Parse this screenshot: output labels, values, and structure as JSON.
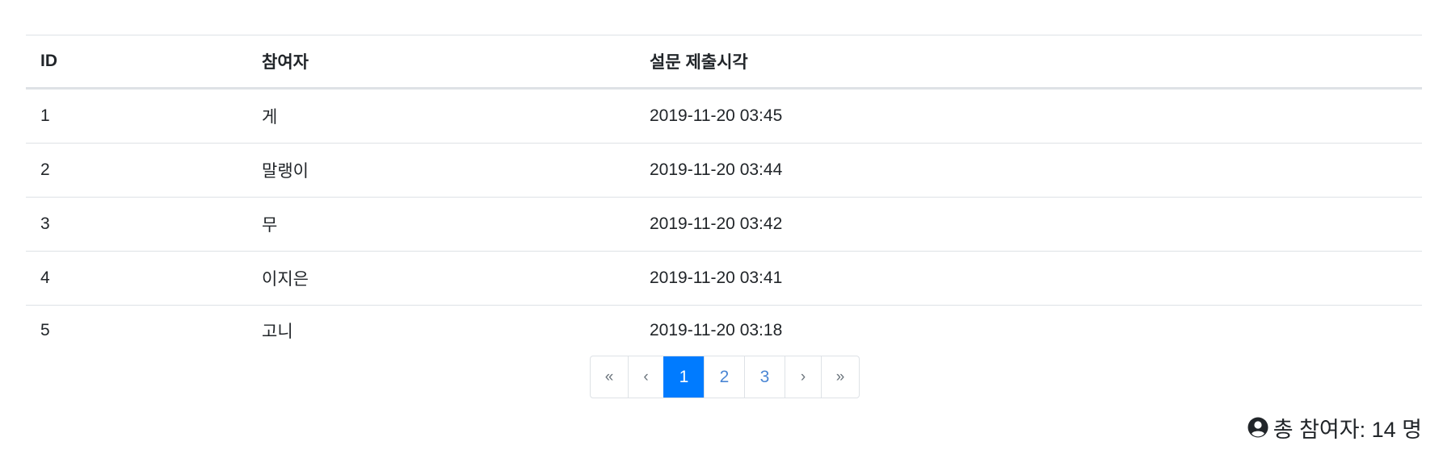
{
  "table": {
    "headers": {
      "id": "ID",
      "participant": "참여자",
      "submitted_at": "설문 제출시각"
    },
    "rows": [
      {
        "id": "1",
        "participant": "게",
        "submitted_at": "2019-11-20 03:45"
      },
      {
        "id": "2",
        "participant": "말랭이",
        "submitted_at": "2019-11-20 03:44"
      },
      {
        "id": "3",
        "participant": "무",
        "submitted_at": "2019-11-20 03:42"
      },
      {
        "id": "4",
        "participant": "이지은",
        "submitted_at": "2019-11-20 03:41"
      },
      {
        "id": "5",
        "participant": "고니",
        "submitted_at": "2019-11-20 03:18"
      }
    ]
  },
  "pagination": {
    "first": "«",
    "prev": "‹",
    "pages": [
      "1",
      "2",
      "3"
    ],
    "active_page": "1",
    "next": "›",
    "last": "»"
  },
  "summary": {
    "icon": "user-circle-icon",
    "total_text": "총 참여자: 14 명"
  },
  "colors": {
    "active_page_bg": "#007bff",
    "link": "#4a86d4",
    "border": "#dee2e6"
  }
}
